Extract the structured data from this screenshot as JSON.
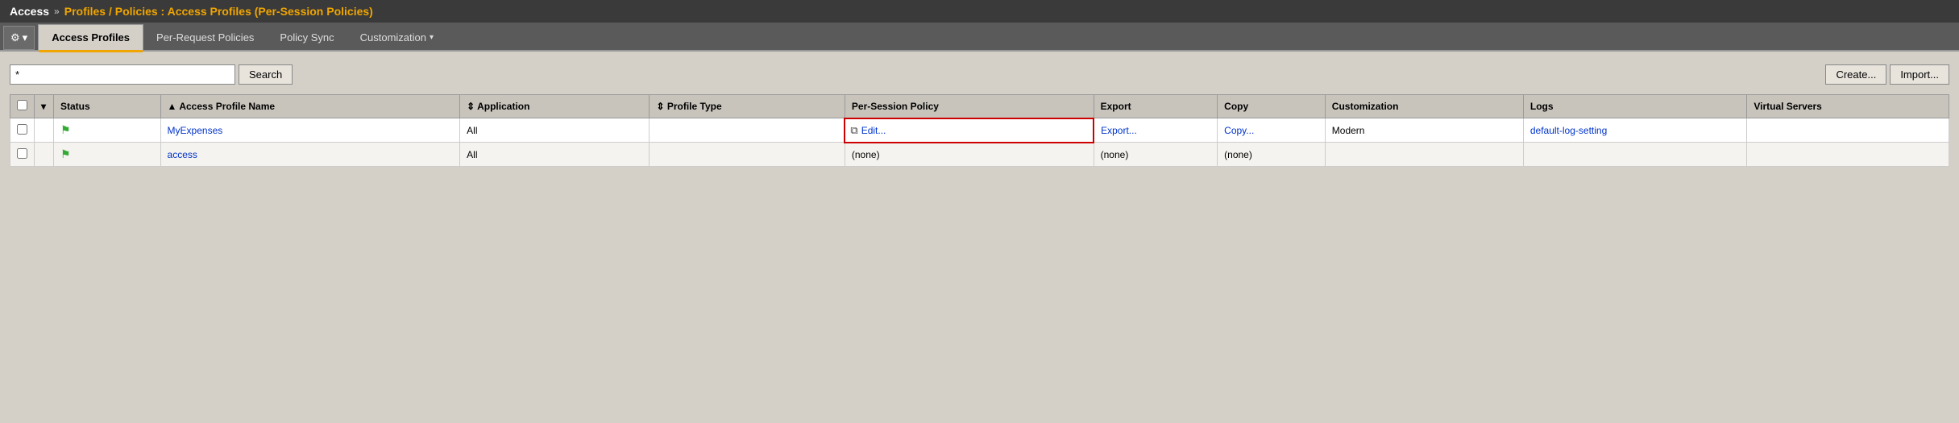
{
  "topnav": {
    "access_label": "Access",
    "separator": "»",
    "path": "Profiles / Policies : Access Profiles (Per-Session Policies)"
  },
  "tabs": {
    "gear_symbol": "⚙",
    "gear_arrow": "▾",
    "items": [
      {
        "id": "access-profiles",
        "label": "Access Profiles",
        "active": true
      },
      {
        "id": "per-request-policies",
        "label": "Per-Request Policies",
        "active": false
      },
      {
        "id": "policy-sync",
        "label": "Policy Sync",
        "active": false
      },
      {
        "id": "customization",
        "label": "Customization",
        "active": false,
        "has_arrow": true
      }
    ]
  },
  "toolbar": {
    "search_placeholder": "*",
    "search_label": "Search",
    "create_label": "Create...",
    "import_label": "Import..."
  },
  "table": {
    "columns": [
      {
        "id": "check",
        "label": ""
      },
      {
        "id": "dropdown",
        "label": ""
      },
      {
        "id": "status",
        "label": "Status"
      },
      {
        "id": "name",
        "label": "Access Profile Name",
        "sort": "asc"
      },
      {
        "id": "application",
        "label": "Application",
        "sort": "none"
      },
      {
        "id": "profile_type",
        "label": "Profile Type",
        "sort": "none"
      },
      {
        "id": "per_session_policy",
        "label": "Per-Session Policy"
      },
      {
        "id": "export",
        "label": "Export"
      },
      {
        "id": "copy",
        "label": "Copy"
      },
      {
        "id": "customization",
        "label": "Customization"
      },
      {
        "id": "logs",
        "label": "Logs"
      },
      {
        "id": "virtual_servers",
        "label": "Virtual Servers"
      }
    ],
    "rows": [
      {
        "id": "row1",
        "status_flag": "▶",
        "name": "MyExpenses",
        "application": "All",
        "profile_type": "",
        "per_session_policy": "Edit...",
        "per_session_highlighted": true,
        "export": "Export...",
        "copy": "Copy...",
        "customization": "Modern",
        "logs": "default-log-setting",
        "virtual_servers": ""
      },
      {
        "id": "row2",
        "status_flag": "▶",
        "name": "access",
        "application": "All",
        "profile_type": "",
        "per_session_policy": "(none)",
        "per_session_highlighted": false,
        "export": "(none)",
        "copy": "(none)",
        "customization": "",
        "logs": "",
        "virtual_servers": ""
      }
    ]
  }
}
